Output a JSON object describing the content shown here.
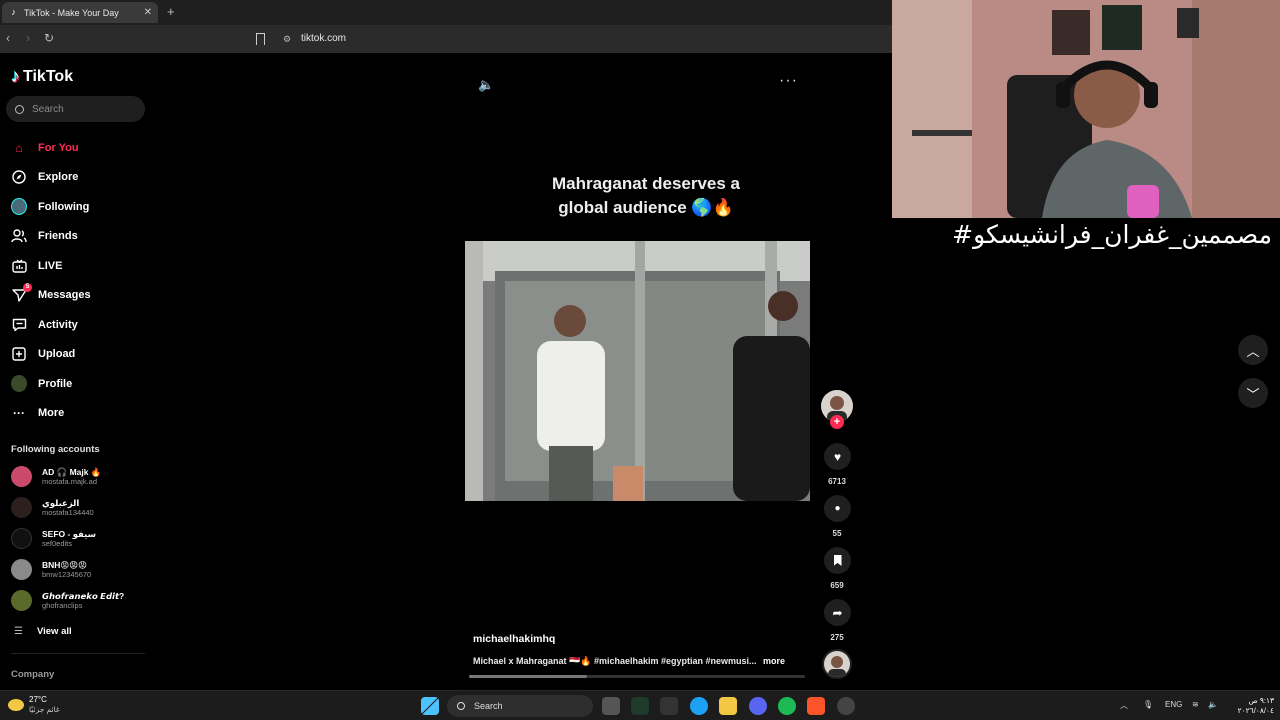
{
  "browser": {
    "tab_title": "TikTok - Make Your Day",
    "new_tab": "+",
    "url": "tiktok.com"
  },
  "sidebar": {
    "logo": "TikTok",
    "search_placeholder": "Search",
    "menu": [
      {
        "label": "For You",
        "icon": "home-icon",
        "active": true
      },
      {
        "label": "Explore",
        "icon": "compass-icon"
      },
      {
        "label": "Following",
        "icon": "following-avatar-icon"
      },
      {
        "label": "Friends",
        "icon": "friends-icon"
      },
      {
        "label": "LIVE",
        "icon": "live-icon"
      },
      {
        "label": "Messages",
        "icon": "messages-icon",
        "badge": "5"
      },
      {
        "label": "Activity",
        "icon": "activity-icon"
      },
      {
        "label": "Upload",
        "icon": "upload-icon"
      },
      {
        "label": "Profile",
        "icon": "profile-avatar-icon"
      },
      {
        "label": "More",
        "icon": "more-dots-icon"
      }
    ],
    "following_title": "Following accounts",
    "accounts": [
      {
        "name": "AD 🎧 Majk 🔥",
        "handle": "mostafa.majk.ad"
      },
      {
        "name": "الزعبلوي",
        "handle": "mostafa134440"
      },
      {
        "name": "SEFO - سيفو",
        "handle": "sef0edits"
      },
      {
        "name": "BNH😡😡😡",
        "handle": "bmw12345670"
      },
      {
        "name": "𝙂𝙝𝙤𝙛𝙧𝙖𝙣𝙚𝙠𝙤 𝙀𝙙𝙞𝙩?",
        "handle": "ghofranclips"
      }
    ],
    "view_all": "View all",
    "company": "Company"
  },
  "video": {
    "caption_line1": "Mahraganat deserves a",
    "caption_line2": "global audience 🌎🔥",
    "author": "michaelhakimhq",
    "description": "Michael x Mahraganat 🇪🇬🔥 #michaelhakim #egyptian #newmusi...",
    "more": "more",
    "progress": 0.35,
    "likes": "6713",
    "comments": "55",
    "saves": "659",
    "shares": "275"
  },
  "overlay": {
    "arabic_caption": "مصممين_غفران_فرانشيسكو#"
  },
  "taskbar": {
    "temp": "27°C",
    "weather_desc": "غائم جزئيًا",
    "search": "Search",
    "lang": "ENG",
    "time": "٩:١٣ ص",
    "date": "٢٠٢٦/٠٨/٠٤"
  }
}
